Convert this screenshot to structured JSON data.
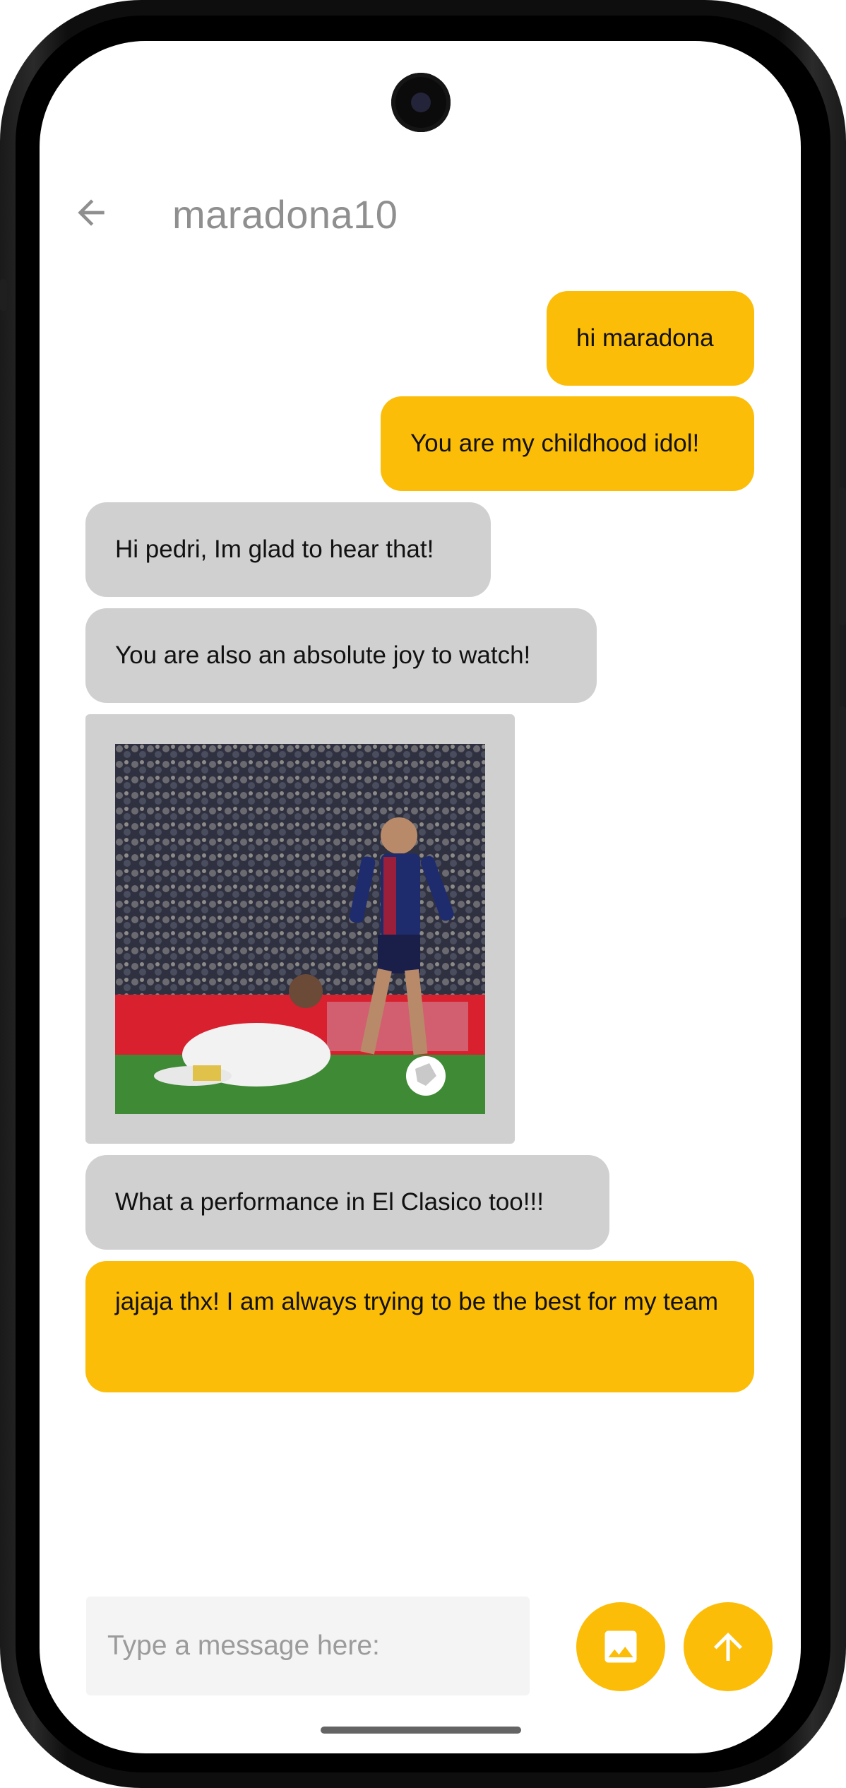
{
  "header": {
    "title": "maradona10",
    "back_icon": "arrow-left-icon"
  },
  "messages": [
    {
      "from": "me",
      "text": "hi maradona"
    },
    {
      "from": "me",
      "text": "You are my childhood idol!"
    },
    {
      "from": "them",
      "text": "Hi pedri, Im glad to hear that!"
    },
    {
      "from": "them",
      "text": "You are also an absolute joy to watch!"
    },
    {
      "from": "them",
      "type": "image",
      "image": "football-match-photo"
    },
    {
      "from": "them",
      "text": "What a performance in El Clasico too!!!"
    },
    {
      "from": "me",
      "text": "jajaja thx! I am always trying to be the best for my team"
    }
  ],
  "composer": {
    "placeholder": "Type a message here:",
    "attach_icon": "image-icon",
    "send_icon": "arrow-up-icon"
  },
  "colors": {
    "sent_bubble": "#fcbd09",
    "received_bubble": "#d0d0d0",
    "title_text": "#8f8f8f"
  }
}
